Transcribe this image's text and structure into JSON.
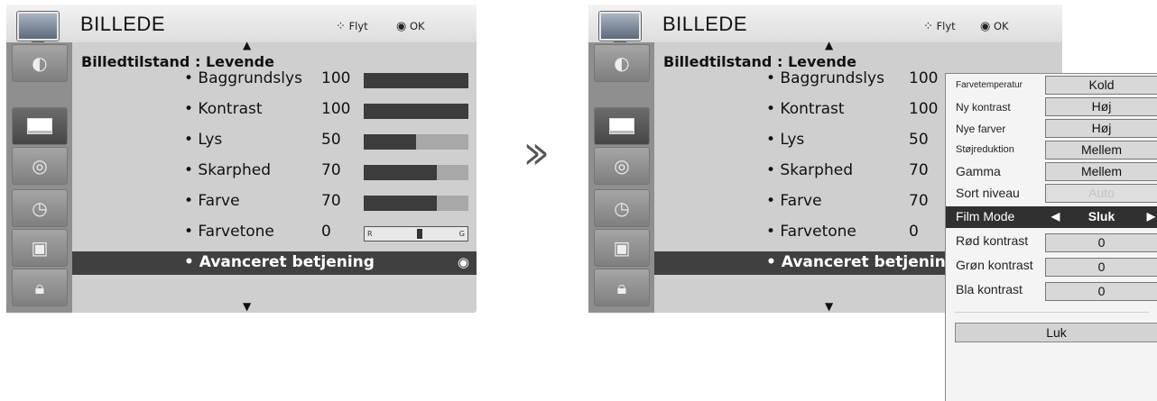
{
  "left_menu": {
    "title": "BILLEDE",
    "hint_move_icon": "move-arrows-icon",
    "hint_move": "Flyt",
    "hint_ok": "OK",
    "sidebar": [
      "picture-globe-icon",
      "tv-icon",
      "speaker-icon",
      "clock-icon",
      "option-box-icon",
      "lock-icon"
    ],
    "mode_label": "Billedtilstand",
    "mode_value": ": Levende",
    "settings": [
      {
        "label": "• Baggrundslys",
        "value": "100",
        "level": 1.0
      },
      {
        "label": "• Kontrast",
        "value": "100",
        "level": 1.0
      },
      {
        "label": "• Lys",
        "value": "50",
        "level": 0.5
      },
      {
        "label": "• Skarphed",
        "value": "70",
        "level": 0.7
      },
      {
        "label": "• Farve",
        "value": "70",
        "level": 0.7
      },
      {
        "label": "• Farvetone",
        "value": "0",
        "tone_r": "R",
        "tone_g": "G"
      }
    ],
    "advanced_label": "• Avanceret betjening"
  },
  "right_menu": {
    "title": "BILLEDE",
    "hint_move": "Flyt",
    "hint_ok": "OK",
    "mode_label": "Billedtilstand",
    "mode_value": ": Levende",
    "settings": [
      {
        "label": "• Baggrundslys",
        "value": "100"
      },
      {
        "label": "• Kontrast",
        "value": "100"
      },
      {
        "label": "• Lys",
        "value": "50"
      },
      {
        "label": "• Skarphed",
        "value": "70"
      },
      {
        "label": "• Farve",
        "value": "70"
      },
      {
        "label": "• Farvetone",
        "value": "0"
      }
    ],
    "advanced_label": "• Avanceret betjening"
  },
  "arrow_glyph": "≫",
  "popup": {
    "rows": [
      {
        "label": "Farvetemperatur",
        "value": "Kold"
      },
      {
        "label": "Ny kontrast",
        "value": "Høj"
      },
      {
        "label": "Nye farver",
        "value": "Høj"
      },
      {
        "label": "Støjreduktion",
        "value": "Mellem"
      },
      {
        "label": "Gamma",
        "value": "Mellem"
      },
      {
        "label": "Sort niveau",
        "value": "Auto"
      },
      {
        "label": "Film Mode",
        "value": "Sluk"
      },
      {
        "label": "Rød kontrast",
        "value": "0"
      },
      {
        "label": "Grøn kontrast",
        "value": "0"
      },
      {
        "label": "Bla kontrast",
        "value": "0"
      }
    ],
    "close_label": "Luk"
  },
  "colors": {
    "panel": "#cfcfcf",
    "sidebar": "#8f8f8f",
    "highlight": "#404040",
    "bar_fill": "#3c3c3c"
  }
}
